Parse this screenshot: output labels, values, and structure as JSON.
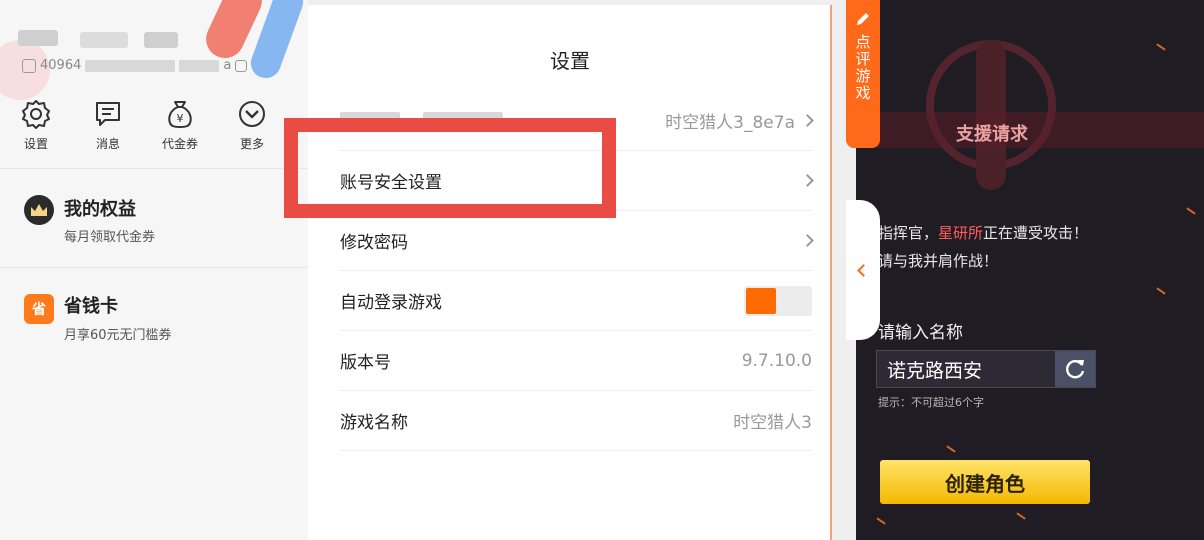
{
  "profile": {
    "uid_prefix": "40964",
    "uid_suffix": "a"
  },
  "quick_actions": [
    {
      "label": "设置",
      "icon": "gear-icon"
    },
    {
      "label": "消息",
      "icon": "message-icon"
    },
    {
      "label": "代金券",
      "icon": "coupon-bag-icon"
    },
    {
      "label": "更多",
      "icon": "more-chevron-icon"
    }
  ],
  "benefits": {
    "title": "我的权益",
    "subtitle": "每月领取代金券"
  },
  "savings_card": {
    "title": "省钱卡",
    "subtitle": "月享60元无门槛券",
    "icon_char": "省"
  },
  "settings": {
    "title": "设置",
    "rows": [
      {
        "label": "",
        "value": "时空猎人3_8e7a"
      },
      {
        "label": "账号安全设置",
        "value": ""
      },
      {
        "label": "修改密码",
        "value": ""
      },
      {
        "label": "自动登录游戏",
        "value": ""
      },
      {
        "label": "版本号",
        "value": "9.7.10.0"
      },
      {
        "label": "游戏名称",
        "value": "时空猎人3"
      }
    ],
    "auto_login_on": true
  },
  "review_tab": {
    "text": "点评游戏"
  },
  "game": {
    "banner_text": "支援请求",
    "line1_prefix": "指挥官，",
    "line1_highlight": "星研所",
    "line1_suffix": "正在遭受攻击！",
    "line2": "请与我并肩作战！",
    "name_label": "请输入名称",
    "name_value": "诺克路西安",
    "hint": "提示：不可超过6个字",
    "create_label": "创建角色"
  },
  "colors": {
    "accent": "#ff6a1a",
    "highlight_box": "#e84c45",
    "game_bg": "#201c23",
    "create_button": "#f5b800"
  }
}
